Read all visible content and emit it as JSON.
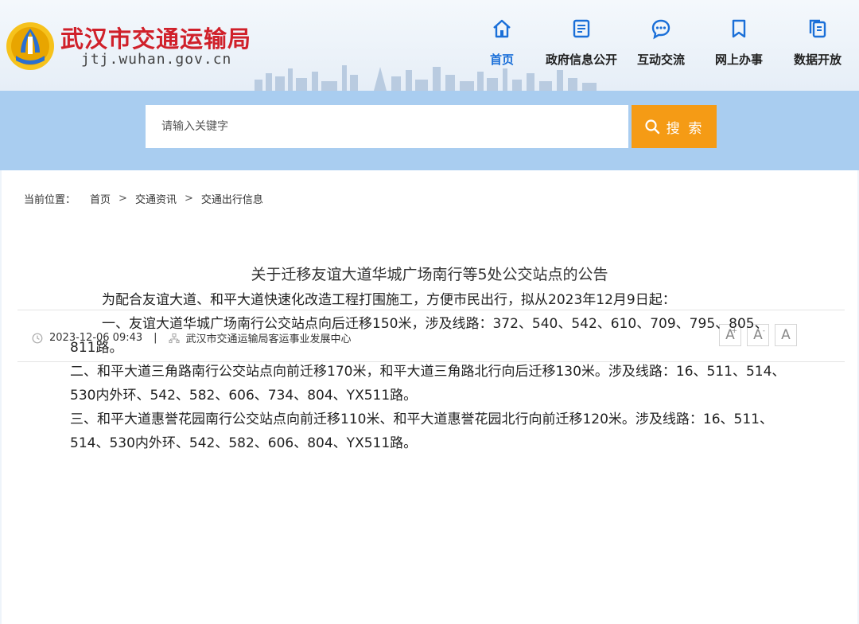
{
  "header": {
    "site_name": "武汉市交通运输局",
    "site_domain": "jtj.wuhan.gov.cn",
    "nav": [
      {
        "label": "首页",
        "icon": "home-icon",
        "active": true
      },
      {
        "label": "政府信息公开",
        "icon": "document-icon",
        "active": false
      },
      {
        "label": "互动交流",
        "icon": "chat-icon",
        "active": false
      },
      {
        "label": "网上办事",
        "icon": "bookmark-icon",
        "active": false
      },
      {
        "label": "数据开放",
        "icon": "copy-icon",
        "active": false
      }
    ]
  },
  "search": {
    "placeholder": "请输入关键字",
    "button_label": "搜 索"
  },
  "breadcrumb": {
    "label": "当前位置：",
    "items": [
      "首页",
      "交通资讯",
      "交通出行信息"
    ],
    "separator": ">"
  },
  "article": {
    "title": "关于迁移友谊大道华城广场南行等5处公交站点的公告",
    "date": "2023-12-06 09:43",
    "meta_separator": "|",
    "source": "武汉市交通运输局客运事业发展中心",
    "font_sizes": [
      "A",
      "A",
      "A"
    ],
    "font_size_marks": [
      "+",
      "-",
      ""
    ],
    "paragraphs": [
      "为配合友谊大道、和平大道快速化改造工程打围施工，方便市民出行，拟从2023年12月9日起：",
      "一、友谊大道华城广场南行公交站点向后迁移150米，涉及线路：372、540、542、610、709、795、805、811路。",
      "二、和平大道三角路南行公交站点向前迁移170米，和平大道三角路北行向后迁移130米。涉及线路：16、511、514、530内外环、542、582、606、734、804、YX511路。",
      "三、和平大道惠誉花园南行公交站点向前迁移110米、和平大道惠誉花园北行向前迁移120米。涉及线路：16、511、514、530内外环、542、582、606、804、YX511路。"
    ]
  },
  "colors": {
    "brand_red": "#d0202a",
    "active_blue": "#1a6fd8",
    "search_orange": "#f59b15",
    "search_band": "#a9cdf0"
  }
}
